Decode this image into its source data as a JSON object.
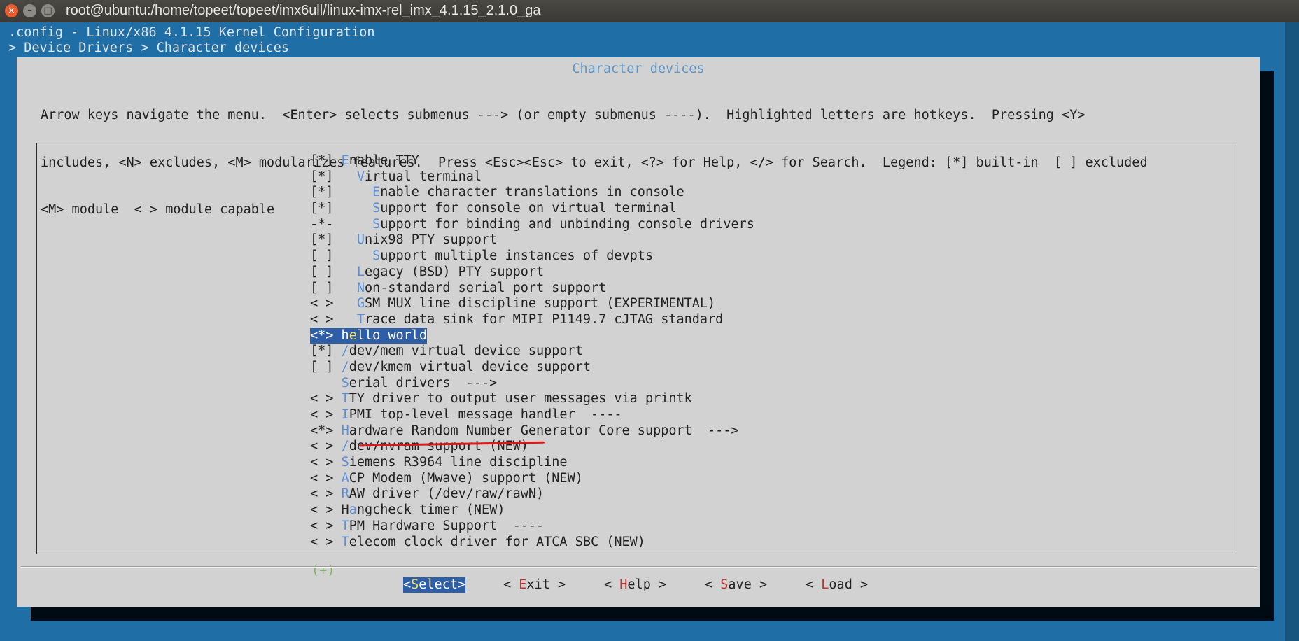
{
  "window": {
    "title": "root@ubuntu:/home/topeet/topeet/imx6ull/linux-imx-rel_imx_4.1.15_2.1.0_ga",
    "close_glyph": "×",
    "min_glyph": "–",
    "max_glyph": "□"
  },
  "terminal": {
    "header_line1": ".config - Linux/x86 4.1.15 Kernel Configuration",
    "header_line2": "> Device Drivers > Character devices"
  },
  "dialog": {
    "title": "Character devices",
    "help_lines": [
      "Arrow keys navigate the menu.  <Enter> selects submenus ---> (or empty submenus ----).  Highlighted letters are hotkeys.  Pressing <Y>",
      "includes, <N> excludes, <M> modularizes features.  Press <Esc><Esc> to exit, <?> for Help, </> for Search.  Legend: [*] built-in  [ ] excluded",
      "<M> module  < > module capable"
    ],
    "more_indicator": "(+)",
    "menu_items": [
      {
        "prefix": "[*] ",
        "hotkey": "E",
        "rest": "nable TTY"
      },
      {
        "prefix": "[*]   ",
        "hotkey": "V",
        "rest": "irtual terminal"
      },
      {
        "prefix": "[*]     ",
        "hotkey": "E",
        "rest": "nable character translations in console"
      },
      {
        "prefix": "[*]     ",
        "hotkey": "S",
        "rest": "upport for console on virtual terminal"
      },
      {
        "prefix": "-*-     ",
        "hotkey": "S",
        "rest": "upport for binding and unbinding console drivers"
      },
      {
        "prefix": "[*]   ",
        "hotkey": "U",
        "rest": "nix98 PTY support"
      },
      {
        "prefix": "[ ]     ",
        "hotkey": "S",
        "rest": "upport multiple instances of devpts"
      },
      {
        "prefix": "[ ]   ",
        "hotkey": "L",
        "rest": "egacy (BSD) PTY support"
      },
      {
        "prefix": "[ ]   ",
        "hotkey": "N",
        "rest": "on-standard serial port support"
      },
      {
        "prefix": "< >   ",
        "hotkey": "G",
        "rest": "SM MUX line discipline support (EXPERIMENTAL)"
      },
      {
        "prefix": "< >   ",
        "hotkey": "T",
        "rest": "race data sink for MIPI P1149.7 cJTAG standard"
      },
      {
        "prefix": "<*> h",
        "hotkey": "e",
        "rest": "llo world",
        "selected": true
      },
      {
        "prefix": "[*] ",
        "hotkey": "/",
        "rest": "dev/mem virtual device support"
      },
      {
        "prefix": "[ ] ",
        "hotkey": "/",
        "rest": "dev/kmem virtual device support"
      },
      {
        "prefix": "    ",
        "hotkey": "S",
        "rest": "erial drivers  --->"
      },
      {
        "prefix": "< > ",
        "hotkey": "T",
        "rest": "TY driver to output user messages via printk"
      },
      {
        "prefix": "< > ",
        "hotkey": "I",
        "rest": "PMI top-level message handler  ----"
      },
      {
        "prefix": "<*> ",
        "hotkey": "H",
        "rest": "ardware Random Number Generator Core support  --->"
      },
      {
        "prefix": "< > ",
        "hotkey": "/",
        "rest": "dev/nvram support (NEW)"
      },
      {
        "prefix": "< > ",
        "hotkey": "S",
        "rest": "iemens R3964 line discipline"
      },
      {
        "prefix": "< > ",
        "hotkey": "A",
        "rest": "CP Modem (Mwave) support (NEW)"
      },
      {
        "prefix": "< > ",
        "hotkey": "R",
        "rest": "AW driver (/dev/raw/rawN)"
      },
      {
        "prefix": "< > H",
        "hotkey": "a",
        "rest": "ngcheck timer (NEW)"
      },
      {
        "prefix": "< > ",
        "hotkey": "T",
        "rest": "PM Hardware Support  ----"
      },
      {
        "prefix": "< > ",
        "hotkey": "T",
        "rest": "elecom clock driver for ATCA SBC (NEW)"
      }
    ],
    "buttons": {
      "select": {
        "pre": "<",
        "hotkey": "S",
        "post": "elect>"
      },
      "exit": {
        "pre": "< ",
        "hotkey": "E",
        "post": "xit >"
      },
      "help": {
        "pre": "< ",
        "hotkey": "H",
        "post": "elp >"
      },
      "save": {
        "pre": "< ",
        "hotkey": "S",
        "post": "ave >"
      },
      "load": {
        "pre": "< ",
        "hotkey": "L",
        "post": "oad >"
      }
    }
  },
  "colors": {
    "terminal_bg": "#1f6fa6",
    "dialog_bg": "#d2d2d2",
    "selection_bg": "#2d5ea6",
    "hotkey": "#5b8fd6",
    "button_hotkey": "#c2322a",
    "annotation_line": "#d91a1a"
  }
}
